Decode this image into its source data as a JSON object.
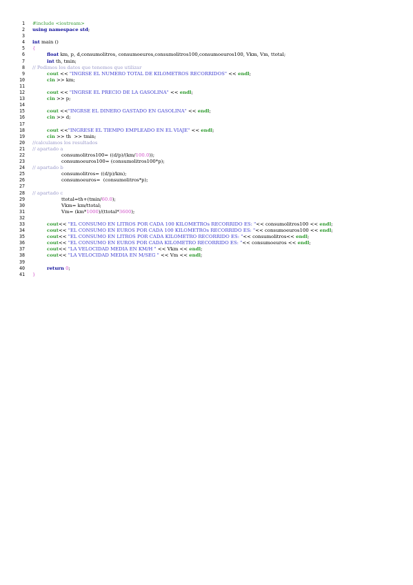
{
  "document": {
    "lines": [
      {
        "n": "1",
        "indent": 0,
        "tokens": [
          {
            "t": "pre",
            "v": "#include <iostream>"
          }
        ]
      },
      {
        "n": "2",
        "indent": 0,
        "tokens": [
          {
            "t": "kw",
            "v": "using namespace std"
          },
          {
            "t": "txt",
            "v": ";"
          }
        ]
      },
      {
        "n": "3",
        "indent": 0,
        "tokens": []
      },
      {
        "n": "4",
        "indent": 0,
        "tokens": [
          {
            "t": "kw",
            "v": "int"
          },
          {
            "t": "txt",
            "v": " main ()"
          }
        ]
      },
      {
        "n": "5",
        "indent": 0,
        "tokens": [
          {
            "t": "num",
            "v": "{"
          }
        ]
      },
      {
        "n": "6",
        "indent": 1,
        "tokens": [
          {
            "t": "kw",
            "v": "float"
          },
          {
            "t": "txt",
            "v": " km, p, d,consumolitros, consumoeuros,consumolitros100,consumoeuros100, Vkm, Vm, ttotal;"
          }
        ]
      },
      {
        "n": "7",
        "indent": 1,
        "tokens": [
          {
            "t": "kw",
            "v": "int"
          },
          {
            "t": "txt",
            "v": " th, tmin;"
          }
        ]
      },
      {
        "n": "8",
        "indent": 0,
        "tokens": [
          {
            "t": "cmt",
            "v": "// Pedimos los datos que tenemos que utilizar"
          }
        ]
      },
      {
        "n": "9",
        "indent": 1,
        "tokens": [
          {
            "t": "out",
            "v": "cout"
          },
          {
            "t": "txt",
            "v": " << "
          },
          {
            "t": "str",
            "v": "\"INGRSE EL NUMERO TOTAL DE KILOMETROS RECORRIDOS\""
          },
          {
            "t": "txt",
            "v": " << "
          },
          {
            "t": "out",
            "v": "endl"
          },
          {
            "t": "txt",
            "v": ";"
          }
        ]
      },
      {
        "n": "10",
        "indent": 1,
        "tokens": [
          {
            "t": "out",
            "v": "cin"
          },
          {
            "t": "txt",
            "v": " >> km;"
          }
        ]
      },
      {
        "n": "11",
        "indent": 0,
        "tokens": []
      },
      {
        "n": "12",
        "indent": 1,
        "tokens": [
          {
            "t": "out",
            "v": "cout"
          },
          {
            "t": "txt",
            "v": " << "
          },
          {
            "t": "str",
            "v": "\"INGRSE EL PRECIO DE LA GASOLINA\""
          },
          {
            "t": "txt",
            "v": " << "
          },
          {
            "t": "out",
            "v": "endl"
          },
          {
            "t": "txt",
            "v": ";"
          }
        ]
      },
      {
        "n": "13",
        "indent": 1,
        "tokens": [
          {
            "t": "out",
            "v": "cin"
          },
          {
            "t": "txt",
            "v": " >> p;"
          }
        ]
      },
      {
        "n": "14",
        "indent": 0,
        "tokens": []
      },
      {
        "n": "15",
        "indent": 1,
        "tokens": [
          {
            "t": "out",
            "v": "cout"
          },
          {
            "t": "txt",
            "v": " <<"
          },
          {
            "t": "str",
            "v": "\"INGRSE EL DINERO GASTADO EN GASOLINA\""
          },
          {
            "t": "txt",
            "v": " << "
          },
          {
            "t": "out",
            "v": "endl"
          },
          {
            "t": "txt",
            "v": ";"
          }
        ]
      },
      {
        "n": "16",
        "indent": 1,
        "tokens": [
          {
            "t": "out",
            "v": "cin"
          },
          {
            "t": "txt",
            "v": " >> d;"
          }
        ]
      },
      {
        "n": "17",
        "indent": 0,
        "tokens": []
      },
      {
        "n": "18",
        "indent": 1,
        "tokens": [
          {
            "t": "out",
            "v": "cout"
          },
          {
            "t": "txt",
            "v": " <<"
          },
          {
            "t": "str",
            "v": "\"INGRESE EL TIEMPO EMPLEADO EN EL VIAJE\""
          },
          {
            "t": "txt",
            "v": " << "
          },
          {
            "t": "out",
            "v": "endl"
          },
          {
            "t": "txt",
            "v": ";"
          }
        ]
      },
      {
        "n": "19",
        "indent": 1,
        "tokens": [
          {
            "t": "out",
            "v": "cin"
          },
          {
            "t": "txt",
            "v": " >> th  >> tmin;"
          }
        ]
      },
      {
        "n": "20",
        "indent": 0,
        "tokens": [
          {
            "t": "cmt",
            "v": "//calculamos los resultados"
          }
        ]
      },
      {
        "n": "21",
        "indent": 0,
        "tokens": [
          {
            "t": "cmt",
            "v": "// apartado a"
          }
        ]
      },
      {
        "n": "22",
        "indent": 2,
        "tokens": [
          {
            "t": "txt",
            "v": "consumolitros100= ((d/p)/(km/"
          },
          {
            "t": "num",
            "v": "100.0"
          },
          {
            "t": "txt",
            "v": "));"
          }
        ]
      },
      {
        "n": "23",
        "indent": 2,
        "tokens": [
          {
            "t": "txt",
            "v": "consumoeuros100= (consumolitros100*p);"
          }
        ]
      },
      {
        "n": "24",
        "indent": 0,
        "tokens": [
          {
            "t": "cmt",
            "v": "// apartado b"
          }
        ]
      },
      {
        "n": "25",
        "indent": 2,
        "tokens": [
          {
            "t": "txt",
            "v": "consumolitros= ((d/p)/km);"
          }
        ]
      },
      {
        "n": "26",
        "indent": 2,
        "tokens": [
          {
            "t": "txt",
            "v": "consumoeuros=  (consumolitros*p);"
          }
        ]
      },
      {
        "n": "27",
        "indent": 0,
        "tokens": []
      },
      {
        "n": "28",
        "indent": 0,
        "tokens": [
          {
            "t": "cmt",
            "v": "// apartado c"
          }
        ]
      },
      {
        "n": "29",
        "indent": 2,
        "tokens": [
          {
            "t": "txt",
            "v": "ttotal=th+(tmin/"
          },
          {
            "t": "num",
            "v": "60.0"
          },
          {
            "t": "txt",
            "v": ");"
          }
        ]
      },
      {
        "n": "30",
        "indent": 2,
        "tokens": [
          {
            "t": "txt",
            "v": "Vkm= km/ttotal;"
          }
        ]
      },
      {
        "n": "31",
        "indent": 2,
        "tokens": [
          {
            "t": "txt",
            "v": "Vm= (km*"
          },
          {
            "t": "num",
            "v": "1000"
          },
          {
            "t": "txt",
            "v": ")/(ttotal*"
          },
          {
            "t": "num",
            "v": "3600"
          },
          {
            "t": "txt",
            "v": ");"
          }
        ]
      },
      {
        "n": "32",
        "indent": 0,
        "tokens": []
      },
      {
        "n": "33",
        "indent": 1,
        "tokens": [
          {
            "t": "out",
            "v": "cout"
          },
          {
            "t": "txt",
            "v": "<< "
          },
          {
            "t": "str",
            "v": "\"EL CONSUMO EN LITROS POR CADA 100 KILOMETROs RECORRIDO ES: \""
          },
          {
            "t": "txt",
            "v": "<< consumolitros100 << "
          },
          {
            "t": "out",
            "v": "endl"
          },
          {
            "t": "txt",
            "v": ";"
          }
        ]
      },
      {
        "n": "34",
        "indent": 1,
        "tokens": [
          {
            "t": "out",
            "v": "cout"
          },
          {
            "t": "txt",
            "v": "<< "
          },
          {
            "t": "str",
            "v": "\"EL CONSUMO EN EUROS POR CADA 100 KILOMETROs RECORRIDO ES: \""
          },
          {
            "t": "txt",
            "v": "<< consumoeuros100 << "
          },
          {
            "t": "out",
            "v": "endl"
          },
          {
            "t": "txt",
            "v": ";"
          }
        ]
      },
      {
        "n": "35",
        "indent": 1,
        "tokens": [
          {
            "t": "out",
            "v": "cout"
          },
          {
            "t": "txt",
            "v": "<< "
          },
          {
            "t": "str",
            "v": "\"EL CONSUMO EN LITROS POR CADA KILOMETRO RECORRIDO ES: \""
          },
          {
            "t": "txt",
            "v": "<< consumolitros<< "
          },
          {
            "t": "out",
            "v": "endl"
          },
          {
            "t": "txt",
            "v": ";"
          }
        ]
      },
      {
        "n": "36",
        "indent": 1,
        "tokens": [
          {
            "t": "out",
            "v": "cout"
          },
          {
            "t": "txt",
            "v": "<< "
          },
          {
            "t": "str",
            "v": "\"EL CONSUMO EN EUROS POR CADA KILOMETRO RECORRIDO ES: \""
          },
          {
            "t": "txt",
            "v": "<< consumoeuros << "
          },
          {
            "t": "out",
            "v": "endl"
          },
          {
            "t": "txt",
            "v": ";"
          }
        ]
      },
      {
        "n": "37",
        "indent": 1,
        "tokens": [
          {
            "t": "out",
            "v": "cout"
          },
          {
            "t": "txt",
            "v": "<< "
          },
          {
            "t": "str",
            "v": "\"LA VELOCIDAD MEDIA EN KM/H \""
          },
          {
            "t": "txt",
            "v": " << Vkm << "
          },
          {
            "t": "out",
            "v": "endl"
          },
          {
            "t": "txt",
            "v": ";"
          }
        ]
      },
      {
        "n": "38",
        "indent": 1,
        "tokens": [
          {
            "t": "out",
            "v": "cout"
          },
          {
            "t": "txt",
            "v": "<< "
          },
          {
            "t": "str",
            "v": "\"LA VELOCIDAD MEDIA EN M/SEG \""
          },
          {
            "t": "txt",
            "v": " << Vm << "
          },
          {
            "t": "out",
            "v": "endl"
          },
          {
            "t": "txt",
            "v": ";"
          }
        ]
      },
      {
        "n": "39",
        "indent": 0,
        "tokens": []
      },
      {
        "n": "40",
        "indent": 1,
        "tokens": [
          {
            "t": "kw",
            "v": "return"
          },
          {
            "t": "txt",
            "v": " "
          },
          {
            "t": "num",
            "v": "0"
          },
          {
            "t": "txt",
            "v": ";"
          }
        ]
      },
      {
        "n": "41",
        "indent": 0,
        "tokens": [
          {
            "t": "num",
            "v": "}"
          }
        ]
      }
    ]
  }
}
